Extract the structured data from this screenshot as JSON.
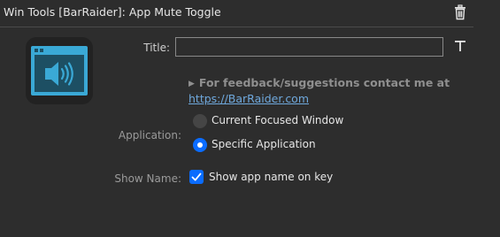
{
  "header": {
    "title": "Win Tools [BarRaider]: App Mute Toggle",
    "delete_icon": "trash-icon"
  },
  "plugin_icon": "speaker-window-icon",
  "title_field": {
    "label": "Title:",
    "value": "",
    "font_button_icon": "text-format-icon"
  },
  "feedback": {
    "text": "For feedback/suggestions contact me at",
    "link": "https://BarRaider.com"
  },
  "application": {
    "label": "Application:",
    "options": [
      {
        "label": "Current Focused Window",
        "selected": false
      },
      {
        "label": "Specific Application",
        "selected": true
      }
    ]
  },
  "show_name": {
    "label": "Show Name:",
    "checkbox_label": "Show app name on key",
    "checked": true
  },
  "colors": {
    "background": "#2d2d2d",
    "accent": "#0a6cff",
    "link": "#6fa8dc",
    "icon_blue": "#3aa9d6"
  }
}
